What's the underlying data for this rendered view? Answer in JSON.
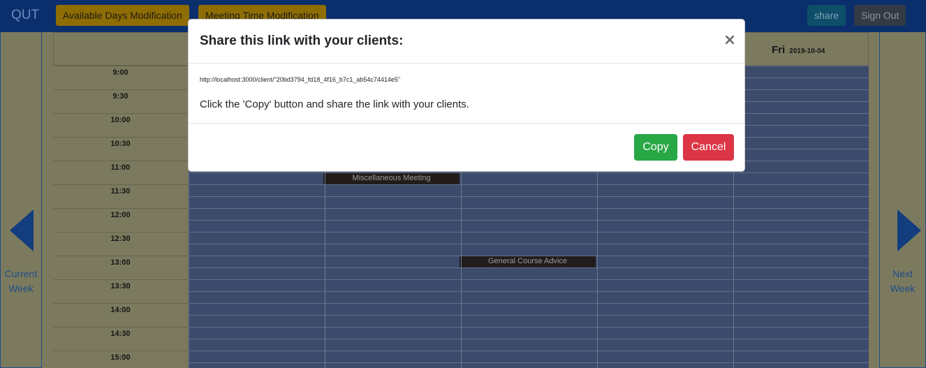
{
  "navbar": {
    "brand": "QUT",
    "available_days_label": "Available Days Modification",
    "meeting_time_label": "Meeting Time Modification",
    "share_label": "share",
    "signout_label": "Sign Out"
  },
  "side_nav": {
    "left_label_line1": "Current",
    "left_label_line2": "Week",
    "right_label_line1": "Next",
    "right_label_line2": "Week"
  },
  "calendar": {
    "visible_day": {
      "name": "Fri",
      "date": "2019-10-04"
    },
    "times": [
      "9:00",
      "9:30",
      "10:00",
      "10:30",
      "11:00",
      "11:30",
      "12:00",
      "12:30",
      "13:00",
      "13:30",
      "14:00",
      "14:30",
      "15:00"
    ],
    "events": [
      {
        "label": "Miscellaneous Meeting"
      },
      {
        "label": "General Course Advice"
      }
    ]
  },
  "modal": {
    "title": "Share this link with your clients:",
    "close_symbol": "×",
    "link": "http://localhost:3000/client/\"20bd3794_fd18_4f16_b7c1_ab54c74414e5\"",
    "instruction": "Click the 'Copy' button and share the link with your clients.",
    "copy_label": "Copy",
    "cancel_label": "Cancel"
  },
  "colors": {
    "navbar": "#0a2f6c",
    "copy_button": "#28a745",
    "cancel_button": "#dc3545",
    "grid_slot": "#3c4a6b"
  }
}
